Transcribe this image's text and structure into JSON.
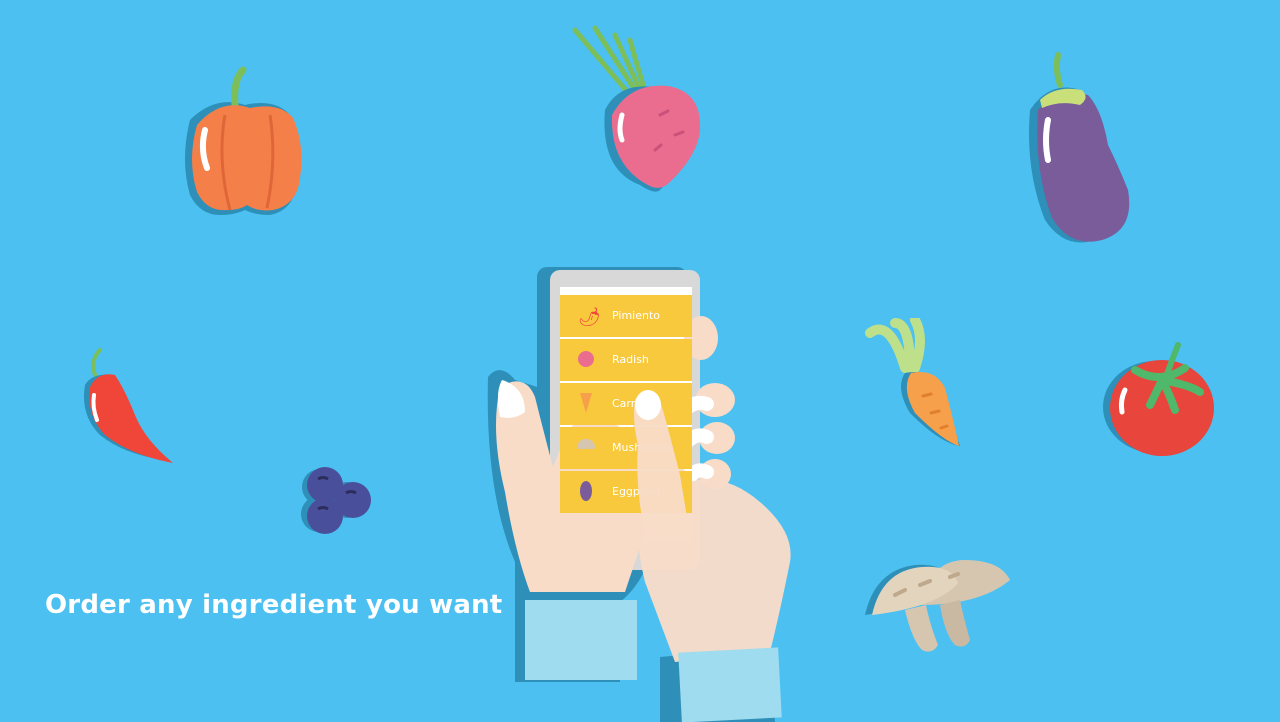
{
  "caption": "Order any ingredient you want",
  "phone": {
    "items": [
      {
        "label": "Pimiento",
        "icon": "chili-pepper-icon"
      },
      {
        "label": "Radish",
        "icon": "radish-icon"
      },
      {
        "label": "Carrot",
        "icon": "carrot-icon"
      },
      {
        "label": "Mushroom",
        "icon": "mushroom-icon"
      },
      {
        "label": "Eggplant",
        "icon": "eggplant-icon"
      }
    ]
  },
  "colors": {
    "background": "#4bc0f1",
    "list_item": "#f8c93d",
    "skin": "#f8dcc8",
    "sleeve": "#9fdcef"
  }
}
